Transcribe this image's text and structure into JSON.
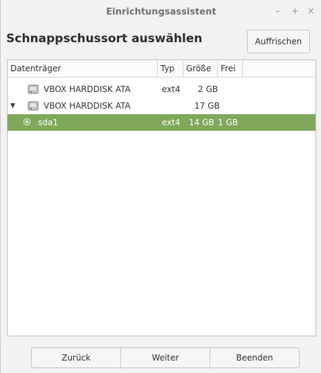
{
  "window": {
    "title": "Einrichtungsassistent",
    "controls": {
      "minimize": "–",
      "maximize": "+",
      "close": "×"
    }
  },
  "page": {
    "heading": "Schnappschussort auswählen",
    "refresh_label": "Auffrischen"
  },
  "table": {
    "columns": [
      "Datenträger",
      "Typ",
      "Größe",
      "Frei"
    ],
    "rows": [
      {
        "name": "VBOX HARDDISK ATA",
        "type": "ext4",
        "size": "2 GB",
        "free": "",
        "icon": "harddisk-icon",
        "expanded": false,
        "selected": false
      },
      {
        "name": "VBOX HARDDISK ATA",
        "type": "",
        "size": "17 GB",
        "free": "",
        "icon": "harddisk-icon",
        "expanded": true,
        "selected": false
      },
      {
        "name": "sda1",
        "type": "ext4",
        "size": "14 GB",
        "free": "1 GB",
        "icon": "radio-selected-icon",
        "expanded": false,
        "selected": true
      }
    ],
    "selection_color": "#7fa85a"
  },
  "footer": {
    "back_label": "Zurück",
    "next_label": "Weiter",
    "finish_label": "Beenden"
  }
}
